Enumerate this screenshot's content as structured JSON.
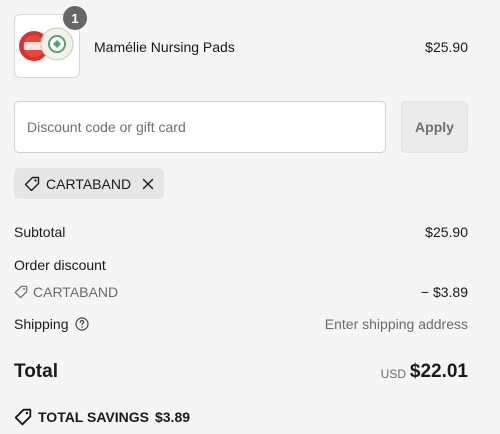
{
  "product": {
    "quantity": "1",
    "name": "Mamélie Nursing Pads",
    "price": "$25.90"
  },
  "discount": {
    "placeholder": "Discount code or gift card",
    "apply_label": "Apply",
    "applied_code": "CARTABAND"
  },
  "summary": {
    "subtotal_label": "Subtotal",
    "subtotal_value": "$25.90",
    "order_discount_label": "Order discount",
    "discount_code": "CARTABAND",
    "discount_value": "− $3.89",
    "shipping_label": "Shipping",
    "shipping_value": "Enter shipping address"
  },
  "total": {
    "label": "Total",
    "currency": "USD",
    "amount": "$22.01"
  },
  "savings": {
    "label": "TOTAL SAVINGS",
    "amount": "$3.89"
  },
  "icons": {
    "tag": "tag-icon",
    "close": "close-icon",
    "info": "info-icon"
  }
}
